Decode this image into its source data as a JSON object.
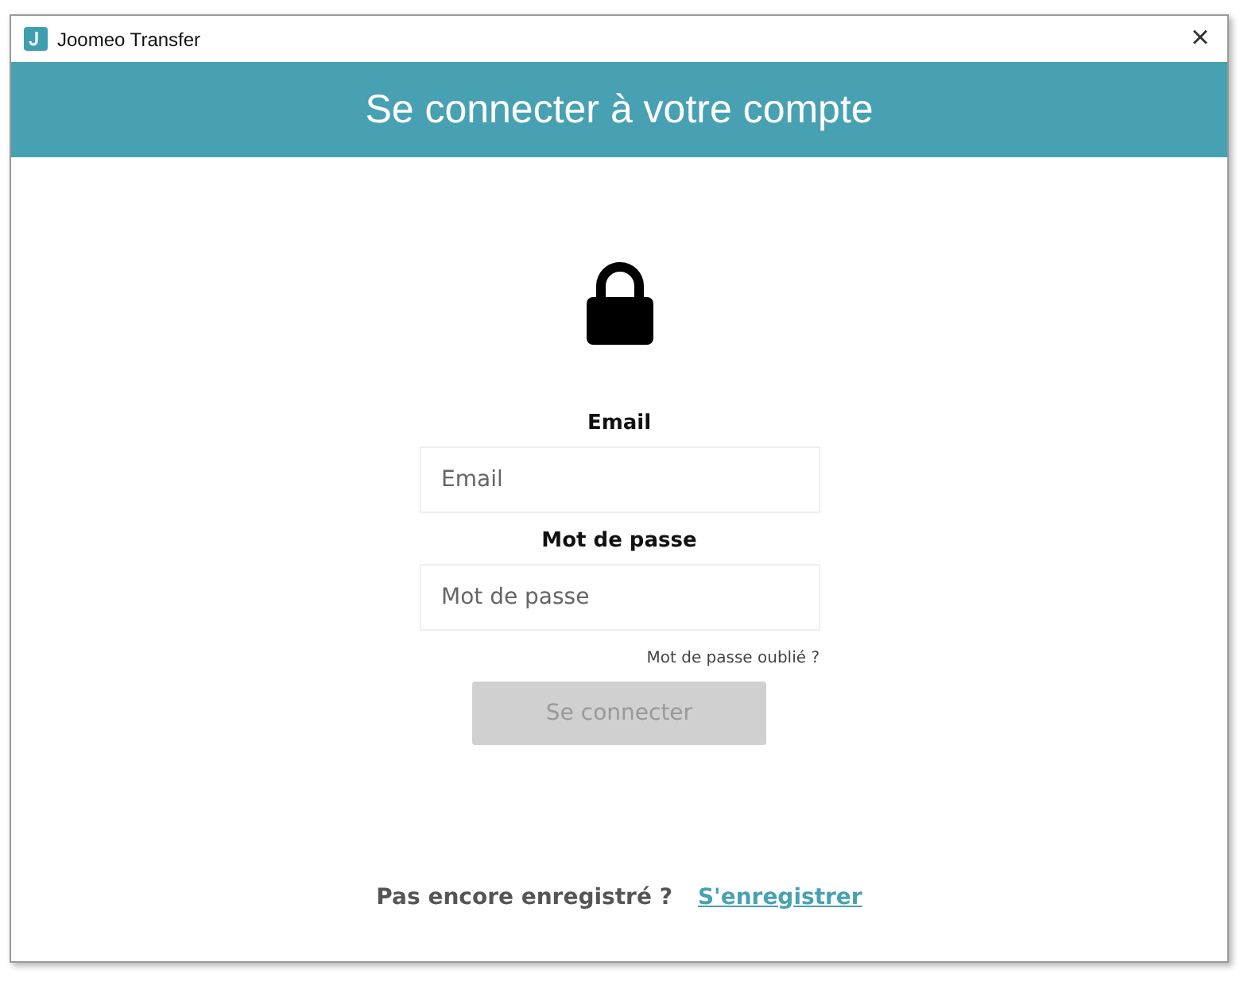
{
  "window": {
    "title": "Joomeo Transfer",
    "close": "×"
  },
  "header": {
    "title": "Se connecter à votre compte"
  },
  "fields": [
    {
      "label": "Email",
      "placeholder": "Email"
    },
    {
      "label": "Mot de passe",
      "placeholder": "Mot de passe"
    }
  ],
  "forgot_link": "Mot de passe oublié ?",
  "submit": {
    "label": "Se connecter",
    "disabled": true
  },
  "footer": {
    "prompt": "Pas encore enregistré ?",
    "link": "S'enregistrer"
  }
}
